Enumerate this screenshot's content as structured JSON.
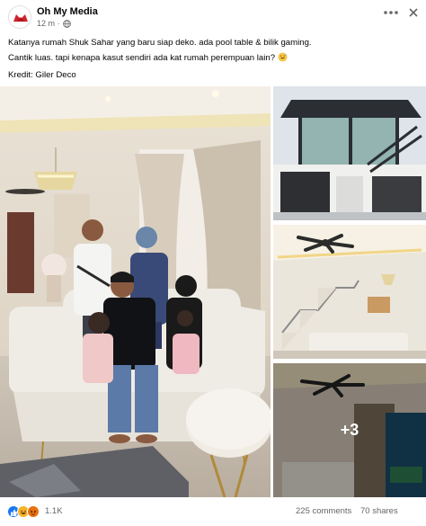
{
  "post": {
    "page_name": "Oh My Media",
    "time": "12 m",
    "separator": "·",
    "caption_lines": [
      "Katanya rumah Shuk Sahar yang baru siap deko. ada pool table & bilik gaming.",
      "Cantik luas. tapi kenapa kasut sendiri ada kat rumah perempuan lain?",
      "Kredit: Giler Deco"
    ],
    "caption_emoji": "sweat-smile-emoji"
  },
  "media": {
    "main_photo": "family-living-room-photo",
    "side_photos": [
      "house-exterior-photo",
      "interior-staircase-photo",
      "interior-room-photo"
    ],
    "more_count": "+3"
  },
  "stats": {
    "reactions_count": "1.1K",
    "comments": "225 comments",
    "shares": "70 shares"
  },
  "colors": {
    "accent": "#1877f2",
    "secondary_text": "#65676b",
    "like": "#1877f2",
    "haha": "#f7b125",
    "angry": "#e9710f"
  },
  "icons": [
    "globe-icon",
    "more-dots-icon",
    "close-icon",
    "like-reaction-icon",
    "haha-reaction-icon",
    "angry-reaction-icon"
  ]
}
